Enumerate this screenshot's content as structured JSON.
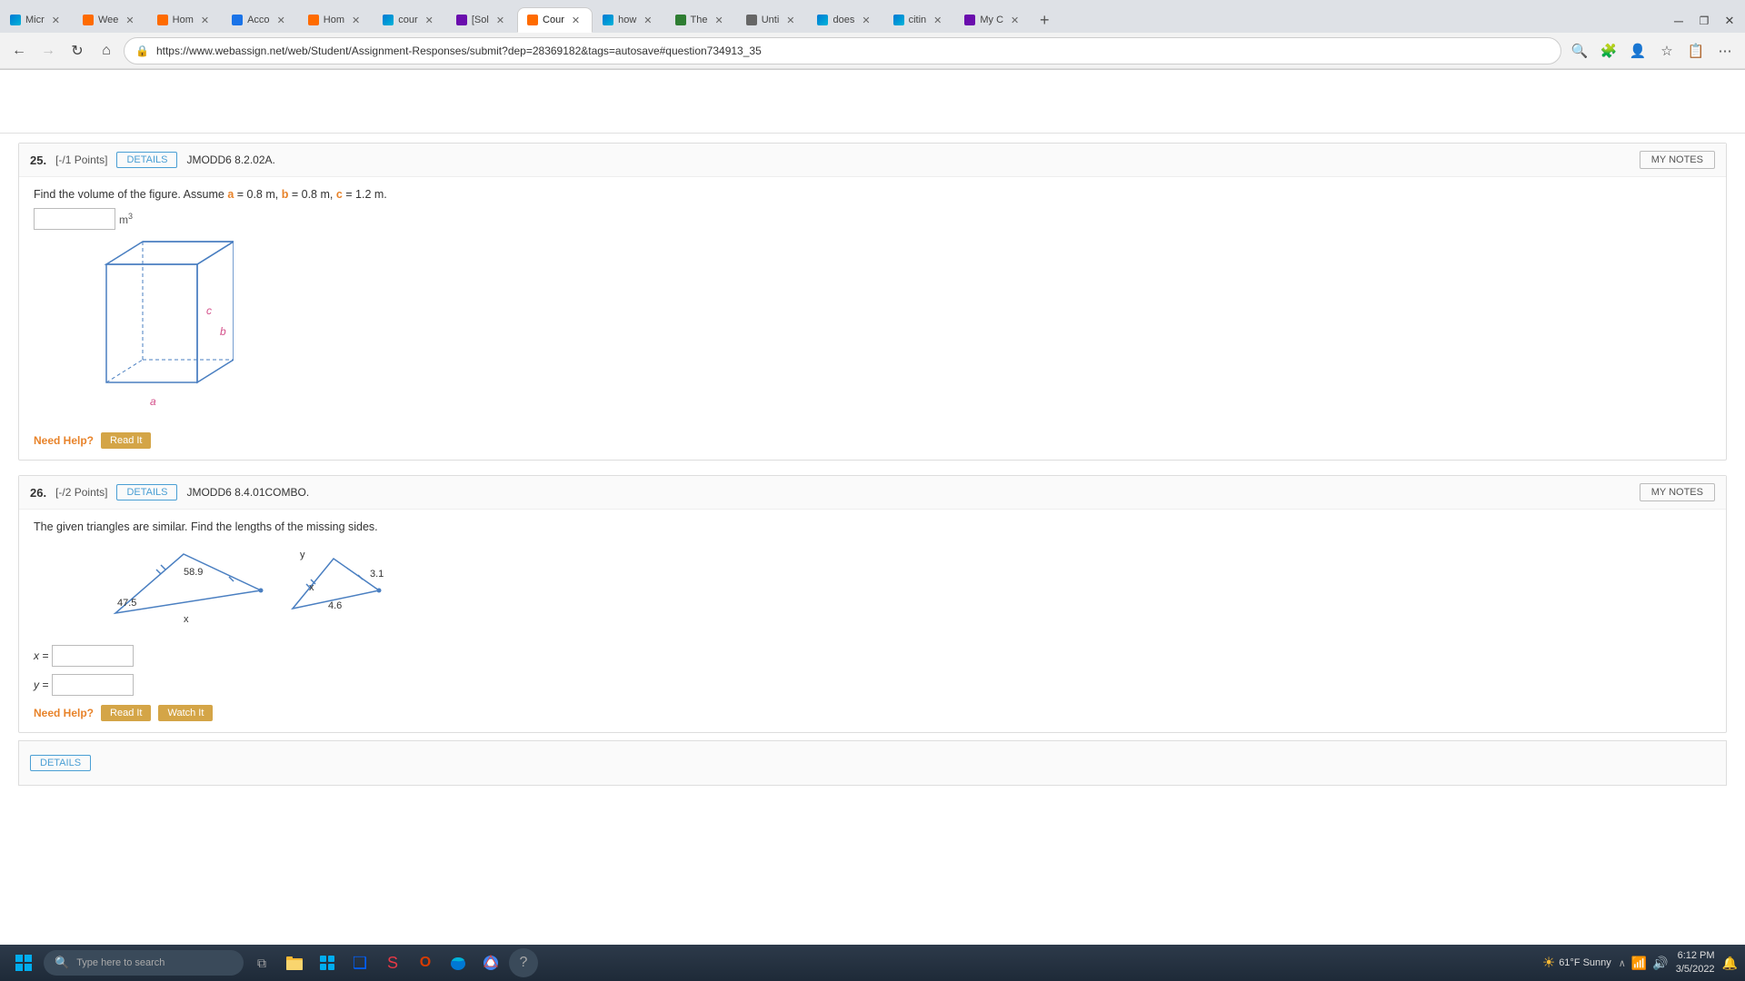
{
  "browser": {
    "url": "https://www.webassign.net/web/Student/Assignment-Responses/submit?dep=28369182&tags=autosave#question734913_35",
    "tabs": [
      {
        "id": 1,
        "label": "Micr",
        "fav": "fav-edge",
        "active": false
      },
      {
        "id": 2,
        "label": "Wee",
        "fav": "fav-orange",
        "active": false
      },
      {
        "id": 3,
        "label": "Hom",
        "fav": "fav-orange",
        "active": false
      },
      {
        "id": 4,
        "label": "Acco",
        "fav": "fav-blue",
        "active": false
      },
      {
        "id": 5,
        "label": "Hom",
        "fav": "fav-orange",
        "active": false
      },
      {
        "id": 6,
        "label": "cour",
        "fav": "fav-edge",
        "active": false
      },
      {
        "id": 7,
        "label": "[Sol",
        "fav": "fav-purple",
        "active": false
      },
      {
        "id": 8,
        "label": "Cour",
        "fav": "fav-orange",
        "active": true
      },
      {
        "id": 9,
        "label": "how",
        "fav": "fav-edge",
        "active": false
      },
      {
        "id": 10,
        "label": "The",
        "fav": "fav-jw",
        "active": false
      },
      {
        "id": 11,
        "label": "Unti",
        "fav": "fav-gray",
        "active": false
      },
      {
        "id": 12,
        "label": "does",
        "fav": "fav-edge",
        "active": false
      },
      {
        "id": 13,
        "label": "citin",
        "fav": "fav-edge",
        "active": false
      },
      {
        "id": 14,
        "label": "My C",
        "fav": "fav-purple",
        "active": false
      }
    ]
  },
  "questions": {
    "q25": {
      "number": "25.",
      "points": "[-/1 Points]",
      "details_btn": "DETAILS",
      "code": "JMODD6 8.2.02A.",
      "my_notes_btn": "MY NOTES",
      "text_prefix": "Find the volume of the figure. Assume ",
      "a_label": "a",
      "a_eq": " = 0.8 m, ",
      "b_label": "b",
      "b_eq": " = 0.8 m, ",
      "c_label": "c",
      "c_eq": " = 1.2 m.",
      "unit": "m³",
      "input_placeholder": "",
      "need_help_text": "Need Help?",
      "read_it_btn": "Read It"
    },
    "q26": {
      "number": "26.",
      "points": "[-/2 Points]",
      "details_btn": "DETAILS",
      "code": "JMODD6 8.4.01COMBO.",
      "my_notes_btn": "MY NOTES",
      "text": "The given triangles are similar. Find the lengths of the missing sides.",
      "x_label": "x =",
      "y_label": "y =",
      "need_help_text": "Need Help?",
      "read_it_btn": "Read It",
      "watch_it_btn": "Watch It",
      "triangle_values": {
        "left_47_5": "47.5",
        "left_58_9": "58.9",
        "right_3_1": "3.1",
        "right_4_6": "4.6",
        "x_label": "x"
      }
    }
  },
  "taskbar": {
    "search_placeholder": "Type here to search",
    "time": "6:12 PM",
    "date": "3/5/2022",
    "weather": "61°F Sunny"
  }
}
